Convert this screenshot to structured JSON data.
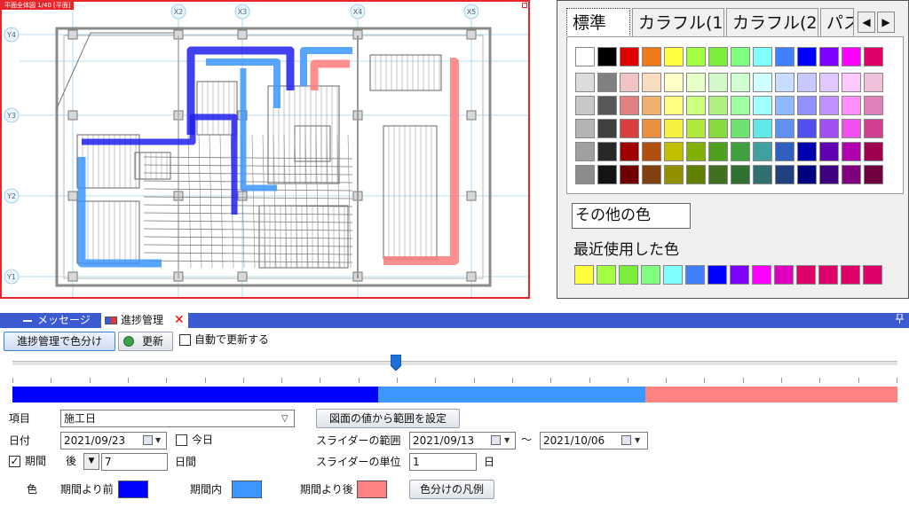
{
  "plan": {
    "title": "平面全体図 1/40 [平面]",
    "grid_labels_top": [
      "X2",
      "X3",
      "X4",
      "X5"
    ],
    "grid_labels_left": [
      "Y4",
      "Y3",
      "Y2",
      "Y1"
    ]
  },
  "palette": {
    "tabs": [
      "標準",
      "カラフル(1)",
      "カラフル(2)",
      "パス"
    ],
    "arrow_left": "◀",
    "arrow_right": "▶",
    "main_colors": [
      "#ffffff",
      "#000000",
      "#e00000",
      "#ee7a1a",
      "#ffff40",
      "#a2ff40",
      "#7aee3a",
      "#80ff80",
      "#80ffff",
      "#4080ff",
      "#0000ff",
      "#8000ff",
      "#ff00ff",
      "#e0006a"
    ],
    "shade_rows": [
      [
        "#dcdcdc",
        "#808080",
        "#f0c4c4",
        "#f8dcc0",
        "#ffffc8",
        "#e6ffc8",
        "#d4f8c8",
        "#d0ffd0",
        "#d0ffff",
        "#c8dcff",
        "#c8c8ff",
        "#e0c8ff",
        "#ffc8ff",
        "#f0c0dc"
      ],
      [
        "#c8c8c8",
        "#585858",
        "#e08080",
        "#f0b070",
        "#ffff80",
        "#ccff80",
        "#b0f080",
        "#a0ffa0",
        "#a0ffff",
        "#90b8ff",
        "#9090ff",
        "#c090ff",
        "#ff90ff",
        "#e080b8"
      ],
      [
        "#b4b4b4",
        "#404040",
        "#d84040",
        "#e89040",
        "#f8f040",
        "#b0e840",
        "#88d840",
        "#70e070",
        "#60e8e8",
        "#6090f0",
        "#5050f0",
        "#a050f0",
        "#f050f0",
        "#d04090"
      ],
      [
        "#a0a0a0",
        "#282828",
        "#a00000",
        "#b05010",
        "#c0c000",
        "#80b000",
        "#50a020",
        "#40a040",
        "#40a0a0",
        "#3060c0",
        "#0000b0",
        "#6000b0",
        "#b000b0",
        "#a00050"
      ],
      [
        "#8c8c8c",
        "#141414",
        "#700000",
        "#804010",
        "#909000",
        "#608000",
        "#407020",
        "#307030",
        "#307070",
        "#204080",
        "#000080",
        "#400080",
        "#800080",
        "#700040"
      ]
    ],
    "other_color_label": "その他の色",
    "recent_label": "最近使用した色",
    "recent_colors": [
      "#ffff40",
      "#a2ff40",
      "#7aee3a",
      "#80ff80",
      "#80ffff",
      "#4080ff",
      "#0000ff",
      "#8000ff",
      "#ff00ff",
      "#e000c0",
      "#e0006a",
      "#e0006a",
      "#e0006a",
      "#e0006a"
    ]
  },
  "tabs": {
    "message": "メッセージ",
    "progress": "進捗管理",
    "close": "✕"
  },
  "toolbar": {
    "color_by_progress": "進捗管理で色分け",
    "refresh": "更新",
    "auto_refresh_label": "自動で更新する"
  },
  "progress_bar": {
    "before_fraction": 0.413,
    "during_fraction": 0.302,
    "after_fraction": 0.285,
    "slider_fraction": 0.433,
    "before_color": "#0000ff",
    "during_color": "#3c96ff",
    "after_color": "#ff8282"
  },
  "form": {
    "item_label": "項目",
    "item_value": "施工日",
    "set_range_button": "図面の値から範囲を設定",
    "date_label": "日付",
    "date_value": "2021/09/23",
    "today_label": "今日",
    "slider_range_label": "スライダーの範囲",
    "range_start": "2021/09/13",
    "range_sep": "〜",
    "range_end": "2021/10/06",
    "period_label": "期間",
    "period_checked": "✓",
    "period_direction": "後",
    "period_value": "7",
    "period_unit": "日間",
    "slider_unit_label": "スライダーの単位",
    "slider_unit_value": "1",
    "slider_unit_suffix": "日",
    "color_label": "色",
    "before_label": "期間より前",
    "during_label": "期間内",
    "after_label": "期間より後",
    "legend_button": "色分けの凡例"
  }
}
